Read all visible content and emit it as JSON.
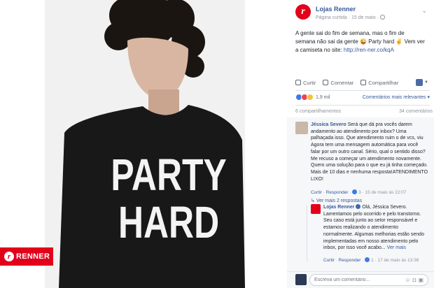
{
  "brand": {
    "wordmark": "RENNER",
    "logo_letter": "r",
    "accent": "#e2001a"
  },
  "shirt": {
    "line1": "PARTY",
    "line2": "HARD"
  },
  "post": {
    "page_name": "Lojas Renner",
    "meta": "Página curtida · 15 de maio ·",
    "menu_icon": "chevron-down-icon",
    "text_prefix": "A gente sai do fim de semana, mas o fim de semana não sai da gente 😜 Party hard ✌ Vem ver a camiseta no site: ",
    "link": "http://ren-ner.co/kqA"
  },
  "actions": {
    "like": "Curtir",
    "comment": "Comentar",
    "share": "Compartilhar"
  },
  "reactions": {
    "count": "1,9 mil",
    "sort_label": "Comentários mais relevantes"
  },
  "stats": {
    "shares": "6 compartilhamentos",
    "comments": "34 comentários"
  },
  "comments": [
    {
      "author": "Jéssica Severo",
      "text": "Será que dá pra vocês darem andamento ao atendimento por inbox? Uma palhaçada isso. Que atendimento ruim o de vcs, viu Agora tem uma mensagem automática para você falar por um outro canal. Sério, qual o sentido disso? Me recuso a começar um atendimento novamente. Quero uma solução para o que eu já tinha começado. Mais de 10 dias e nenhuma resposta!ATENDIMENTO LIXO!",
      "like_label": "Curtir",
      "reply_label": "Responder",
      "likes": "3",
      "time": "15 de maio às 22:07",
      "more_replies": "Ver mais 2 respostas"
    }
  ],
  "reply": {
    "author": "Lojas Renner",
    "text": "Olá, Jéssica Severo. Lamentamos pelo ocorrido e pelo transtorno. Seu caso está junto ao setor responsável e estamos realizando o atendimento normalmente. Algumas melhorias estão sendo implementadas em nosso atendimento pelo inbox, por isso você acabo...",
    "see_more": "Ver mais",
    "like_label": "Curtir",
    "reply_label": "Responder",
    "likes": "1",
    "time": "17 de maio às 13:36"
  },
  "composer": {
    "placeholder": "Escreva um comentário..."
  }
}
